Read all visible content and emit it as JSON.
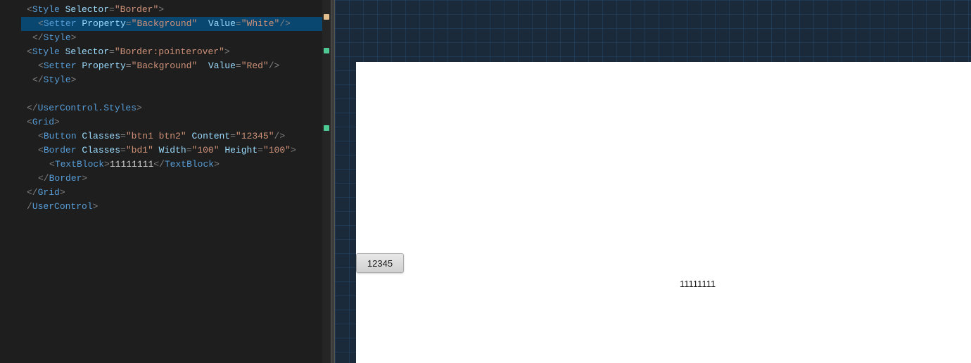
{
  "editor": {
    "lines": [
      {
        "id": 1,
        "indent": 0,
        "tokens": [
          {
            "type": "tag-bracket",
            "text": "<"
          },
          {
            "type": "tag-name",
            "text": "Style"
          },
          {
            "type": "attr-name",
            "text": " Selector"
          },
          {
            "type": "tag-bracket",
            "text": "="
          },
          {
            "type": "attr-value",
            "text": "\"Border\""
          },
          {
            "type": "tag-bracket",
            "text": ">"
          }
        ]
      },
      {
        "id": 2,
        "indent": 2,
        "highlight": true,
        "tokens": [
          {
            "type": "tag-bracket",
            "text": "<"
          },
          {
            "type": "tag-name",
            "text": "Setter"
          },
          {
            "type": "attr-name",
            "text": " Property"
          },
          {
            "type": "tag-bracket",
            "text": "="
          },
          {
            "type": "attr-value",
            "text": "\"Background\""
          },
          {
            "type": "text-content",
            "text": "  "
          },
          {
            "type": "attr-name",
            "text": "Value"
          },
          {
            "type": "tag-bracket",
            "text": "="
          },
          {
            "type": "attr-value",
            "text": "\"White\""
          },
          {
            "type": "slash",
            "text": "/>"
          }
        ]
      },
      {
        "id": 3,
        "indent": 1,
        "tokens": [
          {
            "type": "tag-bracket",
            "text": "</"
          },
          {
            "type": "tag-name",
            "text": "Style"
          },
          {
            "type": "tag-bracket",
            "text": ">"
          }
        ]
      },
      {
        "id": 4,
        "indent": 0,
        "tokens": [
          {
            "type": "tag-bracket",
            "text": "<"
          },
          {
            "type": "tag-name",
            "text": "Style"
          },
          {
            "type": "attr-name",
            "text": " Selector"
          },
          {
            "type": "tag-bracket",
            "text": "="
          },
          {
            "type": "attr-value",
            "text": "\"Border:pointerover\""
          },
          {
            "type": "tag-bracket",
            "text": ">"
          }
        ]
      },
      {
        "id": 5,
        "indent": 2,
        "tokens": [
          {
            "type": "tag-bracket",
            "text": "<"
          },
          {
            "type": "tag-name",
            "text": "Setter"
          },
          {
            "type": "attr-name",
            "text": " Property"
          },
          {
            "type": "tag-bracket",
            "text": "="
          },
          {
            "type": "attr-value",
            "text": "\"Background\""
          },
          {
            "type": "text-content",
            "text": "  "
          },
          {
            "type": "attr-name",
            "text": "Value"
          },
          {
            "type": "tag-bracket",
            "text": "="
          },
          {
            "type": "attr-value",
            "text": "\"Red\""
          },
          {
            "type": "slash",
            "text": "/>"
          }
        ]
      },
      {
        "id": 6,
        "indent": 1,
        "tokens": [
          {
            "type": "tag-bracket",
            "text": "</"
          },
          {
            "type": "tag-name",
            "text": "Style"
          },
          {
            "type": "tag-bracket",
            "text": ">"
          }
        ]
      },
      {
        "id": 7,
        "blank": true
      },
      {
        "id": 8,
        "indent": 0,
        "tokens": [
          {
            "type": "tag-bracket",
            "text": "</"
          },
          {
            "type": "tag-name",
            "text": "UserControl.Styles"
          },
          {
            "type": "tag-bracket",
            "text": ">"
          }
        ]
      },
      {
        "id": 9,
        "indent": 0,
        "tokens": [
          {
            "type": "tag-bracket",
            "text": "<"
          },
          {
            "type": "tag-name",
            "text": "Grid"
          },
          {
            "type": "tag-bracket",
            "text": ">"
          }
        ]
      },
      {
        "id": 10,
        "indent": 2,
        "tokens": [
          {
            "type": "tag-bracket",
            "text": "<"
          },
          {
            "type": "tag-name",
            "text": "Button"
          },
          {
            "type": "attr-name",
            "text": " Classes"
          },
          {
            "type": "tag-bracket",
            "text": "="
          },
          {
            "type": "attr-value",
            "text": "\"btn1 btn2\""
          },
          {
            "type": "attr-name",
            "text": " Content"
          },
          {
            "type": "tag-bracket",
            "text": "="
          },
          {
            "type": "attr-value",
            "text": "\"12345\""
          },
          {
            "type": "slash",
            "text": "/>"
          }
        ]
      },
      {
        "id": 11,
        "indent": 2,
        "tokens": [
          {
            "type": "tag-bracket",
            "text": "<"
          },
          {
            "type": "tag-name",
            "text": "Border"
          },
          {
            "type": "attr-name",
            "text": " Classes"
          },
          {
            "type": "tag-bracket",
            "text": "="
          },
          {
            "type": "attr-value",
            "text": "\"bd1\""
          },
          {
            "type": "attr-name",
            "text": " Width"
          },
          {
            "type": "tag-bracket",
            "text": "="
          },
          {
            "type": "attr-value",
            "text": "\"100\""
          },
          {
            "type": "attr-name",
            "text": " Height"
          },
          {
            "type": "tag-bracket",
            "text": "="
          },
          {
            "type": "attr-value",
            "text": "\"100\""
          },
          {
            "type": "tag-bracket",
            "text": ">"
          }
        ]
      },
      {
        "id": 12,
        "indent": 4,
        "tokens": [
          {
            "type": "tag-bracket",
            "text": "<"
          },
          {
            "type": "tag-name",
            "text": "TextBlock"
          },
          {
            "type": "tag-bracket",
            "text": ">"
          },
          {
            "type": "text-content",
            "text": "11111111"
          },
          {
            "type": "tag-bracket",
            "text": "</"
          },
          {
            "type": "tag-name",
            "text": "TextBlock"
          },
          {
            "type": "tag-bracket",
            "text": ">"
          }
        ]
      },
      {
        "id": 13,
        "indent": 2,
        "tokens": [
          {
            "type": "tag-bracket",
            "text": "</"
          },
          {
            "type": "tag-name",
            "text": "Border"
          },
          {
            "type": "tag-bracket",
            "text": ">"
          }
        ]
      },
      {
        "id": 14,
        "indent": 0,
        "tokens": [
          {
            "type": "tag-bracket",
            "text": "</"
          },
          {
            "type": "tag-name",
            "text": "Grid"
          },
          {
            "type": "tag-bracket",
            "text": ">"
          }
        ]
      },
      {
        "id": 15,
        "indent": 0,
        "tokens": [
          {
            "type": "tag-bracket",
            "text": "/"
          },
          {
            "type": "tag-name",
            "text": "UserControl"
          },
          {
            "type": "tag-bracket",
            "text": ">"
          }
        ]
      }
    ],
    "indicators": [
      {
        "color": "yellow",
        "line": 2
      },
      {
        "color": "green",
        "line": 4
      },
      {
        "color": "green",
        "line": 10
      }
    ]
  },
  "preview": {
    "button_label": "12345",
    "textblock_value": "11111111"
  }
}
